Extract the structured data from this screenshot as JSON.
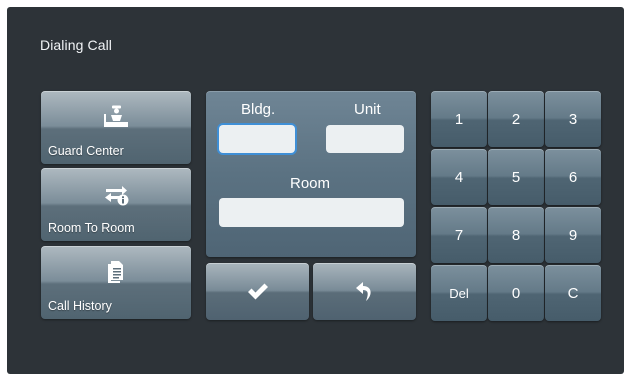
{
  "screen": {
    "title": "Dialing Call"
  },
  "nav": {
    "guard_center": {
      "label": "Guard Center",
      "icon": "guard-icon"
    },
    "room_to_room": {
      "label": "Room To Room",
      "icon": "transfer-icon"
    },
    "call_history": {
      "label": "Call History",
      "icon": "document-icon"
    }
  },
  "form": {
    "bldg_label": "Bldg.",
    "unit_label": "Unit",
    "room_label": "Room",
    "bldg_value": "",
    "unit_value": "",
    "room_value": ""
  },
  "actions": {
    "confirm_icon": "checkmark-icon",
    "back_icon": "back-arrow-icon"
  },
  "keypad": {
    "keys": [
      "1",
      "2",
      "3",
      "4",
      "5",
      "6",
      "7",
      "8",
      "9",
      "Del",
      "0",
      "C"
    ]
  },
  "colors": {
    "background": "#2d3338",
    "active_field_border": "#3f8fd6"
  }
}
